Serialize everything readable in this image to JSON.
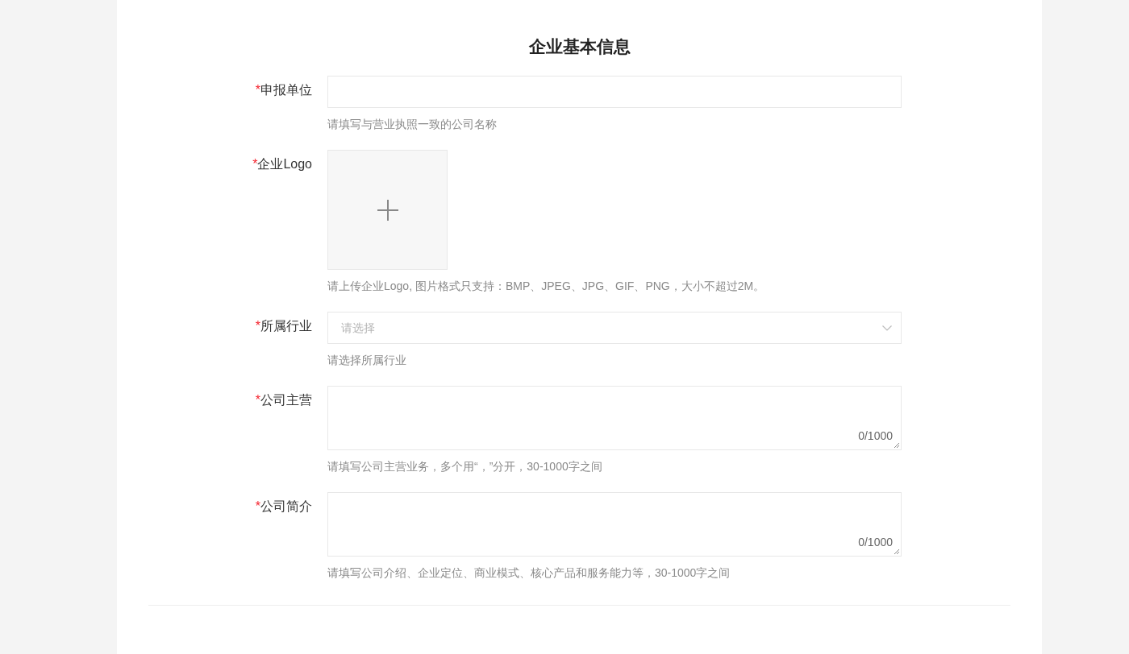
{
  "title": "企业基本信息",
  "fields": [
    {
      "kind": "text",
      "required_mark": "*",
      "label": "申报单位",
      "help": "请填写与营业执照一致的公司名称"
    },
    {
      "kind": "upload",
      "required_mark": "*",
      "label": "企业Logo",
      "help": "请上传企业Logo, 图片格式只支持：BMP、JPEG、JPG、GIF、PNG，大小不超过2M。"
    },
    {
      "kind": "select",
      "required_mark": "*",
      "label": "所属行业",
      "placeholder": "请选择",
      "help": "请选择所属行业"
    },
    {
      "kind": "textarea",
      "required_mark": "*",
      "label": "公司主营",
      "counter": "0/1000",
      "help": "请填写公司主营业务，多个用“，”分开，30-1000字之间"
    },
    {
      "kind": "textarea",
      "required_mark": "*",
      "label": "公司简介",
      "counter": "0/1000",
      "help": "请填写公司介绍、企业定位、商业模式、核心产品和服务能力等，30-1000字之间"
    }
  ]
}
